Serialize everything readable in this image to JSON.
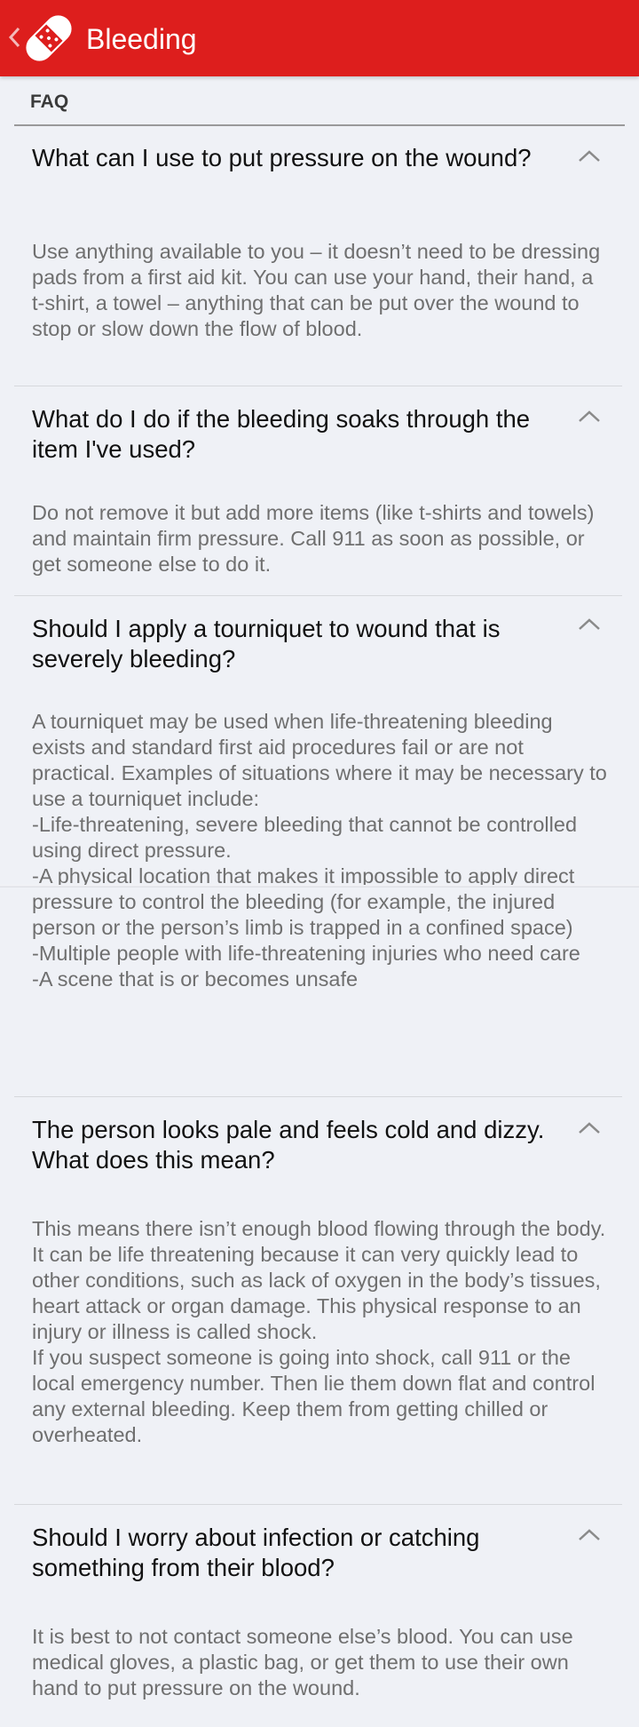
{
  "header": {
    "title": "Bleeding",
    "colors": {
      "bar": "#dd1e1d",
      "text": "#ffffff"
    }
  },
  "section": {
    "label": "FAQ"
  },
  "faqs": [
    {
      "question": "What can I use to put pressure on the wound?",
      "answer": "Use anything available to you – it doesn’t need to be dressing pads from a first aid kit. You can use your hand, their hand, a t-shirt, a towel – anything that can be put over the wound to stop or slow down the flow of blood.",
      "expanded": true
    },
    {
      "question": "What do I do if the bleeding soaks through the item I've used?",
      "answer": "Do not remove it but add more items (like t-shirts and towels) and maintain firm pressure. Call 911 as soon as possible, or get someone else to do it.",
      "expanded": true
    },
    {
      "question": "Should I apply a tourniquet to wound that is severely bleeding?",
      "answer": "A tourniquet may be used when life-threatening bleeding exists and standard first aid procedures fail or are not practical. Examples of situations where it may be necessary to use a tourniquet include:\n-Life-threatening, severe bleeding that cannot be controlled using direct pressure.\n-A physical location that makes it impossible to apply direct pressure to control the bleeding (for example, the injured person or the person’s limb is trapped in a confined space)\n-Multiple people with life-threatening injuries who need care\n-A scene that is or becomes unsafe",
      "expanded": true
    },
    {
      "question": "The person looks pale and feels cold and dizzy. What does this mean?",
      "answer": "This means there isn’t enough blood flowing through the body. It can be life threatening because it can very quickly lead to other conditions, such as lack of oxygen in the body’s tissues, heart attack or organ damage. This physical response to an injury or illness is called shock.\nIf you suspect someone is going into shock, call 911 or the local emergency number. Then lie them down flat and control any external bleeding. Keep them from getting chilled or overheated.",
      "expanded": true
    },
    {
      "question": "Should I worry about infection or catching something from their blood?",
      "answer": "It is best to not contact someone else’s blood. You can use medical gloves, a plastic bag, or get them to use their own hand to put pressure on the wound.",
      "expanded": true
    }
  ]
}
